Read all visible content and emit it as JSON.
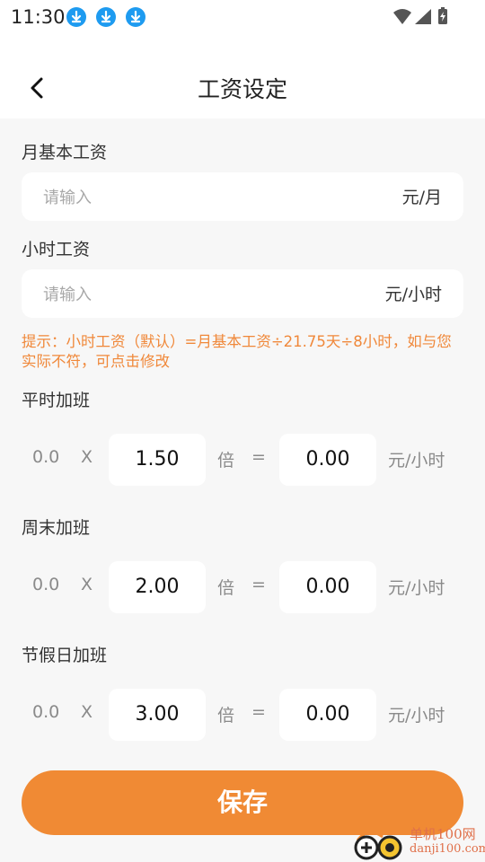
{
  "status_bar": {
    "time": "11:30",
    "notification_icons": [
      "download-icon",
      "download-icon",
      "download-icon"
    ],
    "system_icons": [
      "wifi-icon",
      "signal-icon",
      "battery-charging-icon"
    ]
  },
  "header": {
    "title": "工资设定",
    "back_icon": "chevron-left-icon"
  },
  "monthly": {
    "label": "月基本工资",
    "placeholder": "请输入",
    "unit": "元/月"
  },
  "hourly": {
    "label": "小时工资",
    "placeholder": "请输入",
    "unit": "元/小时"
  },
  "hint": "提示：小时工资（默认）=月基本工资÷21.75天÷8小时，如与您实际不符，可点击修改",
  "overtime": [
    {
      "label": "平时加班",
      "base": "0.0",
      "x": "X",
      "multiplier": "1.50",
      "bei": "倍",
      "eq": "=",
      "result": "0.00",
      "unit": "元/小时"
    },
    {
      "label": "周末加班",
      "base": "0.0",
      "x": "X",
      "multiplier": "2.00",
      "bei": "倍",
      "eq": "=",
      "result": "0.00",
      "unit": "元/小时"
    },
    {
      "label": "节假日加班",
      "base": "0.0",
      "x": "X",
      "multiplier": "3.00",
      "bei": "倍",
      "eq": "=",
      "result": "0.00",
      "unit": "元/小时"
    }
  ],
  "save_label": "保存",
  "watermark": {
    "name": "单机100网",
    "url": "danji100.com"
  },
  "colors": {
    "accent": "#f08a34",
    "hint": "#f0883a",
    "background": "#f7f7f7",
    "download_badge": "#1e9bf0"
  }
}
